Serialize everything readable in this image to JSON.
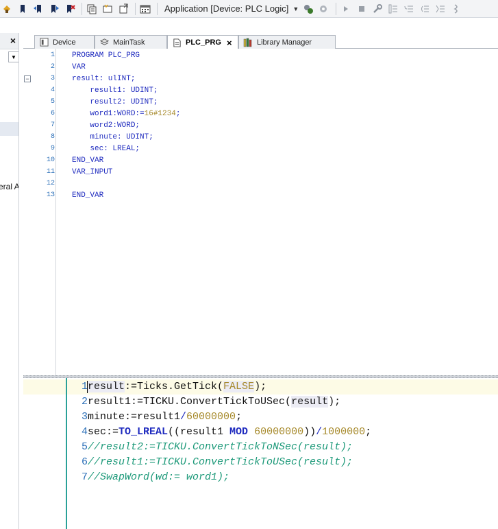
{
  "toolbar": {
    "application_selector": "Application [Device: PLC Logic]",
    "icons": [
      "login-icon",
      "bookmark-icon",
      "prev-bookmark-icon",
      "next-bookmark-icon",
      "clear-bookmark-icon",
      "copy-icon",
      "insert-icon",
      "export-icon",
      "calendar-icon",
      "build-icon",
      "rebuild-icon",
      "run-icon",
      "stop-icon",
      "reset-icon",
      "step-into-icon",
      "step-over-icon",
      "step-out-icon",
      "breakpoint-icon"
    ]
  },
  "left_panel": {
    "close_label": "×",
    "partial_item": "eral Ax"
  },
  "tabs": [
    {
      "label": "Device",
      "icon": "device-icon",
      "active": false
    },
    {
      "label": "MainTask",
      "icon": "task-icon",
      "active": false
    },
    {
      "label": "PLC_PRG",
      "icon": "pou-icon",
      "active": true,
      "close": "×"
    },
    {
      "label": "Library Manager",
      "icon": "library-icon",
      "active": false
    }
  ],
  "declaration": {
    "lines": [
      {
        "n": "1",
        "text": "PROGRAM PLC_PRG"
      },
      {
        "n": "2",
        "text": "VAR"
      },
      {
        "n": "3",
        "text": "result: ulINT;"
      },
      {
        "n": "4",
        "text": "    result1: UDINT;"
      },
      {
        "n": "5",
        "text": "    result2: UDINT;"
      },
      {
        "n": "6",
        "text": "    word1:WORD:=16#1234;"
      },
      {
        "n": "7",
        "text": "    word2:WORD;"
      },
      {
        "n": "8",
        "text": "    minute: UDINT;"
      },
      {
        "n": "9",
        "text": "    sec: LREAL;"
      },
      {
        "n": "10",
        "text": "END_VAR"
      },
      {
        "n": "11",
        "text": "VAR_INPUT"
      },
      {
        "n": "12",
        "text": ""
      },
      {
        "n": "13",
        "text": "END_VAR"
      }
    ]
  },
  "implementation": {
    "lines": [
      {
        "n": "1",
        "text": "result:=Ticks.GetTick(FALSE);"
      },
      {
        "n": "2",
        "text": "result1:=TICKU.ConvertTickToUSec(result);"
      },
      {
        "n": "3",
        "text": "minute:=result1/60000000;"
      },
      {
        "n": "4",
        "text": "sec:=TO_LREAL((result1 MOD 60000000))/1000000;"
      },
      {
        "n": "5",
        "text": "//result2:=TICKU.ConvertTickToNSec(result);"
      },
      {
        "n": "6",
        "text": "//result1:=TICKU.ConvertTickToUSec(result);"
      },
      {
        "n": "7",
        "text": "//SwapWord(wd:= word1);"
      }
    ]
  },
  "colors": {
    "keyword": "#1f2bbf",
    "number": "#a6892a",
    "comment": "#1e9a7a",
    "line_number": "#2b6fb8",
    "gutter_accent": "#2aa198"
  }
}
